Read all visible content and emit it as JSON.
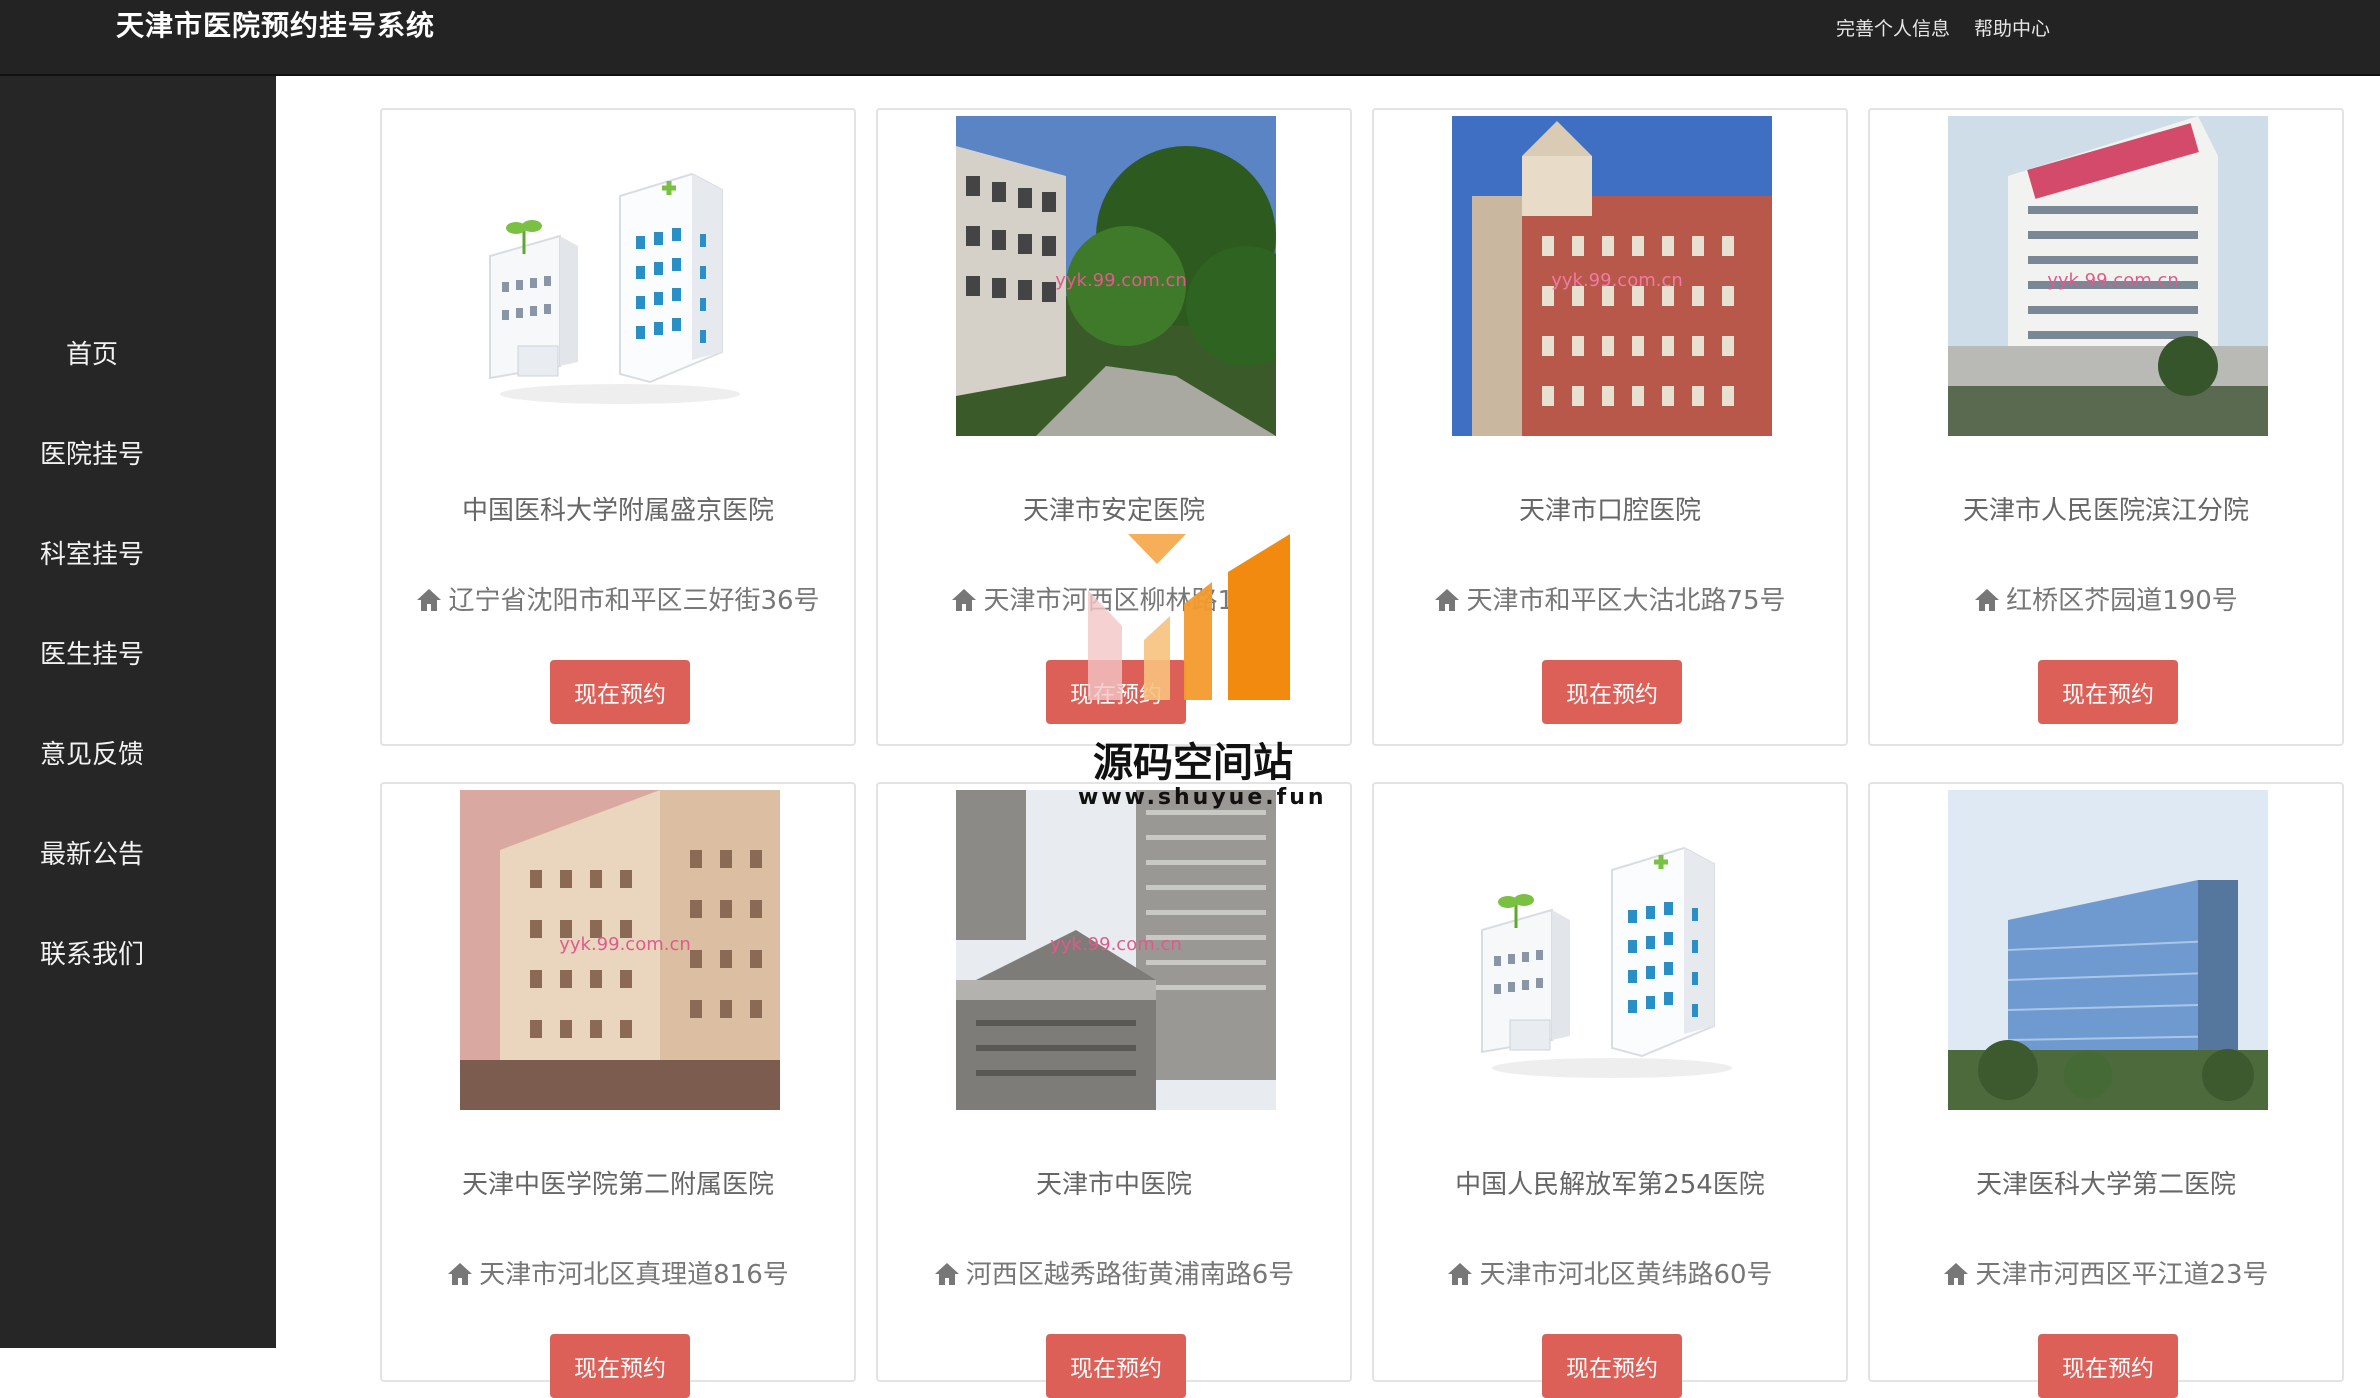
{
  "header": {
    "title": "天津市医院预约挂号系统",
    "links": [
      "完善个人信息",
      "帮助中心"
    ]
  },
  "sidebar": {
    "items": [
      "首页",
      "医院挂号",
      "科室挂号",
      "医生挂号",
      "意见反馈",
      "最新公告",
      "联系我们"
    ]
  },
  "hospitals": [
    {
      "name": "中国医科大学附属盛京医院",
      "address": "辽宁省沈阳市和平区三好街36号",
      "button": "现在预约",
      "photo": "clipart"
    },
    {
      "name": "天津市安定医院",
      "address": "天津市河西区柳林路13号",
      "button": "现在预约",
      "photo": "photo",
      "photo_text": "yyk.99.com.cn"
    },
    {
      "name": "天津市口腔医院",
      "address": "天津市和平区大沽北路75号",
      "button": "现在预约",
      "photo": "photo",
      "photo_text": "yyk.99.com.cn"
    },
    {
      "name": "天津市人民医院滨江分院",
      "address": "红桥区芥园道190号",
      "button": "现在预约",
      "photo": "photo",
      "photo_text": "yyk.99.com.cn"
    },
    {
      "name": "天津中医学院第二附属医院",
      "address": "天津市河北区真理道816号",
      "button": "现在预约",
      "photo": "photo",
      "photo_text": "yyk.99.com.cn"
    },
    {
      "name": "天津市中医院",
      "address": "河西区越秀路街黄浦南路6号",
      "button": "现在预约",
      "photo": "photo",
      "photo_text": "yyk.99.com.cn"
    },
    {
      "name": "中国人民解放军第254医院",
      "address": "天津市河北区黄纬路60号",
      "button": "现在预约",
      "photo": "clipart"
    },
    {
      "name": "天津医科大学第二医院",
      "address": "天津市河西区平江道23号",
      "button": "现在预约",
      "photo": "photo"
    }
  ],
  "watermark": {
    "title": "源码空间站",
    "url": "www.shuyue.fun"
  },
  "colors": {
    "header_bg": "#232323",
    "sidebar_bg": "#262626",
    "button": "#dc6058"
  }
}
